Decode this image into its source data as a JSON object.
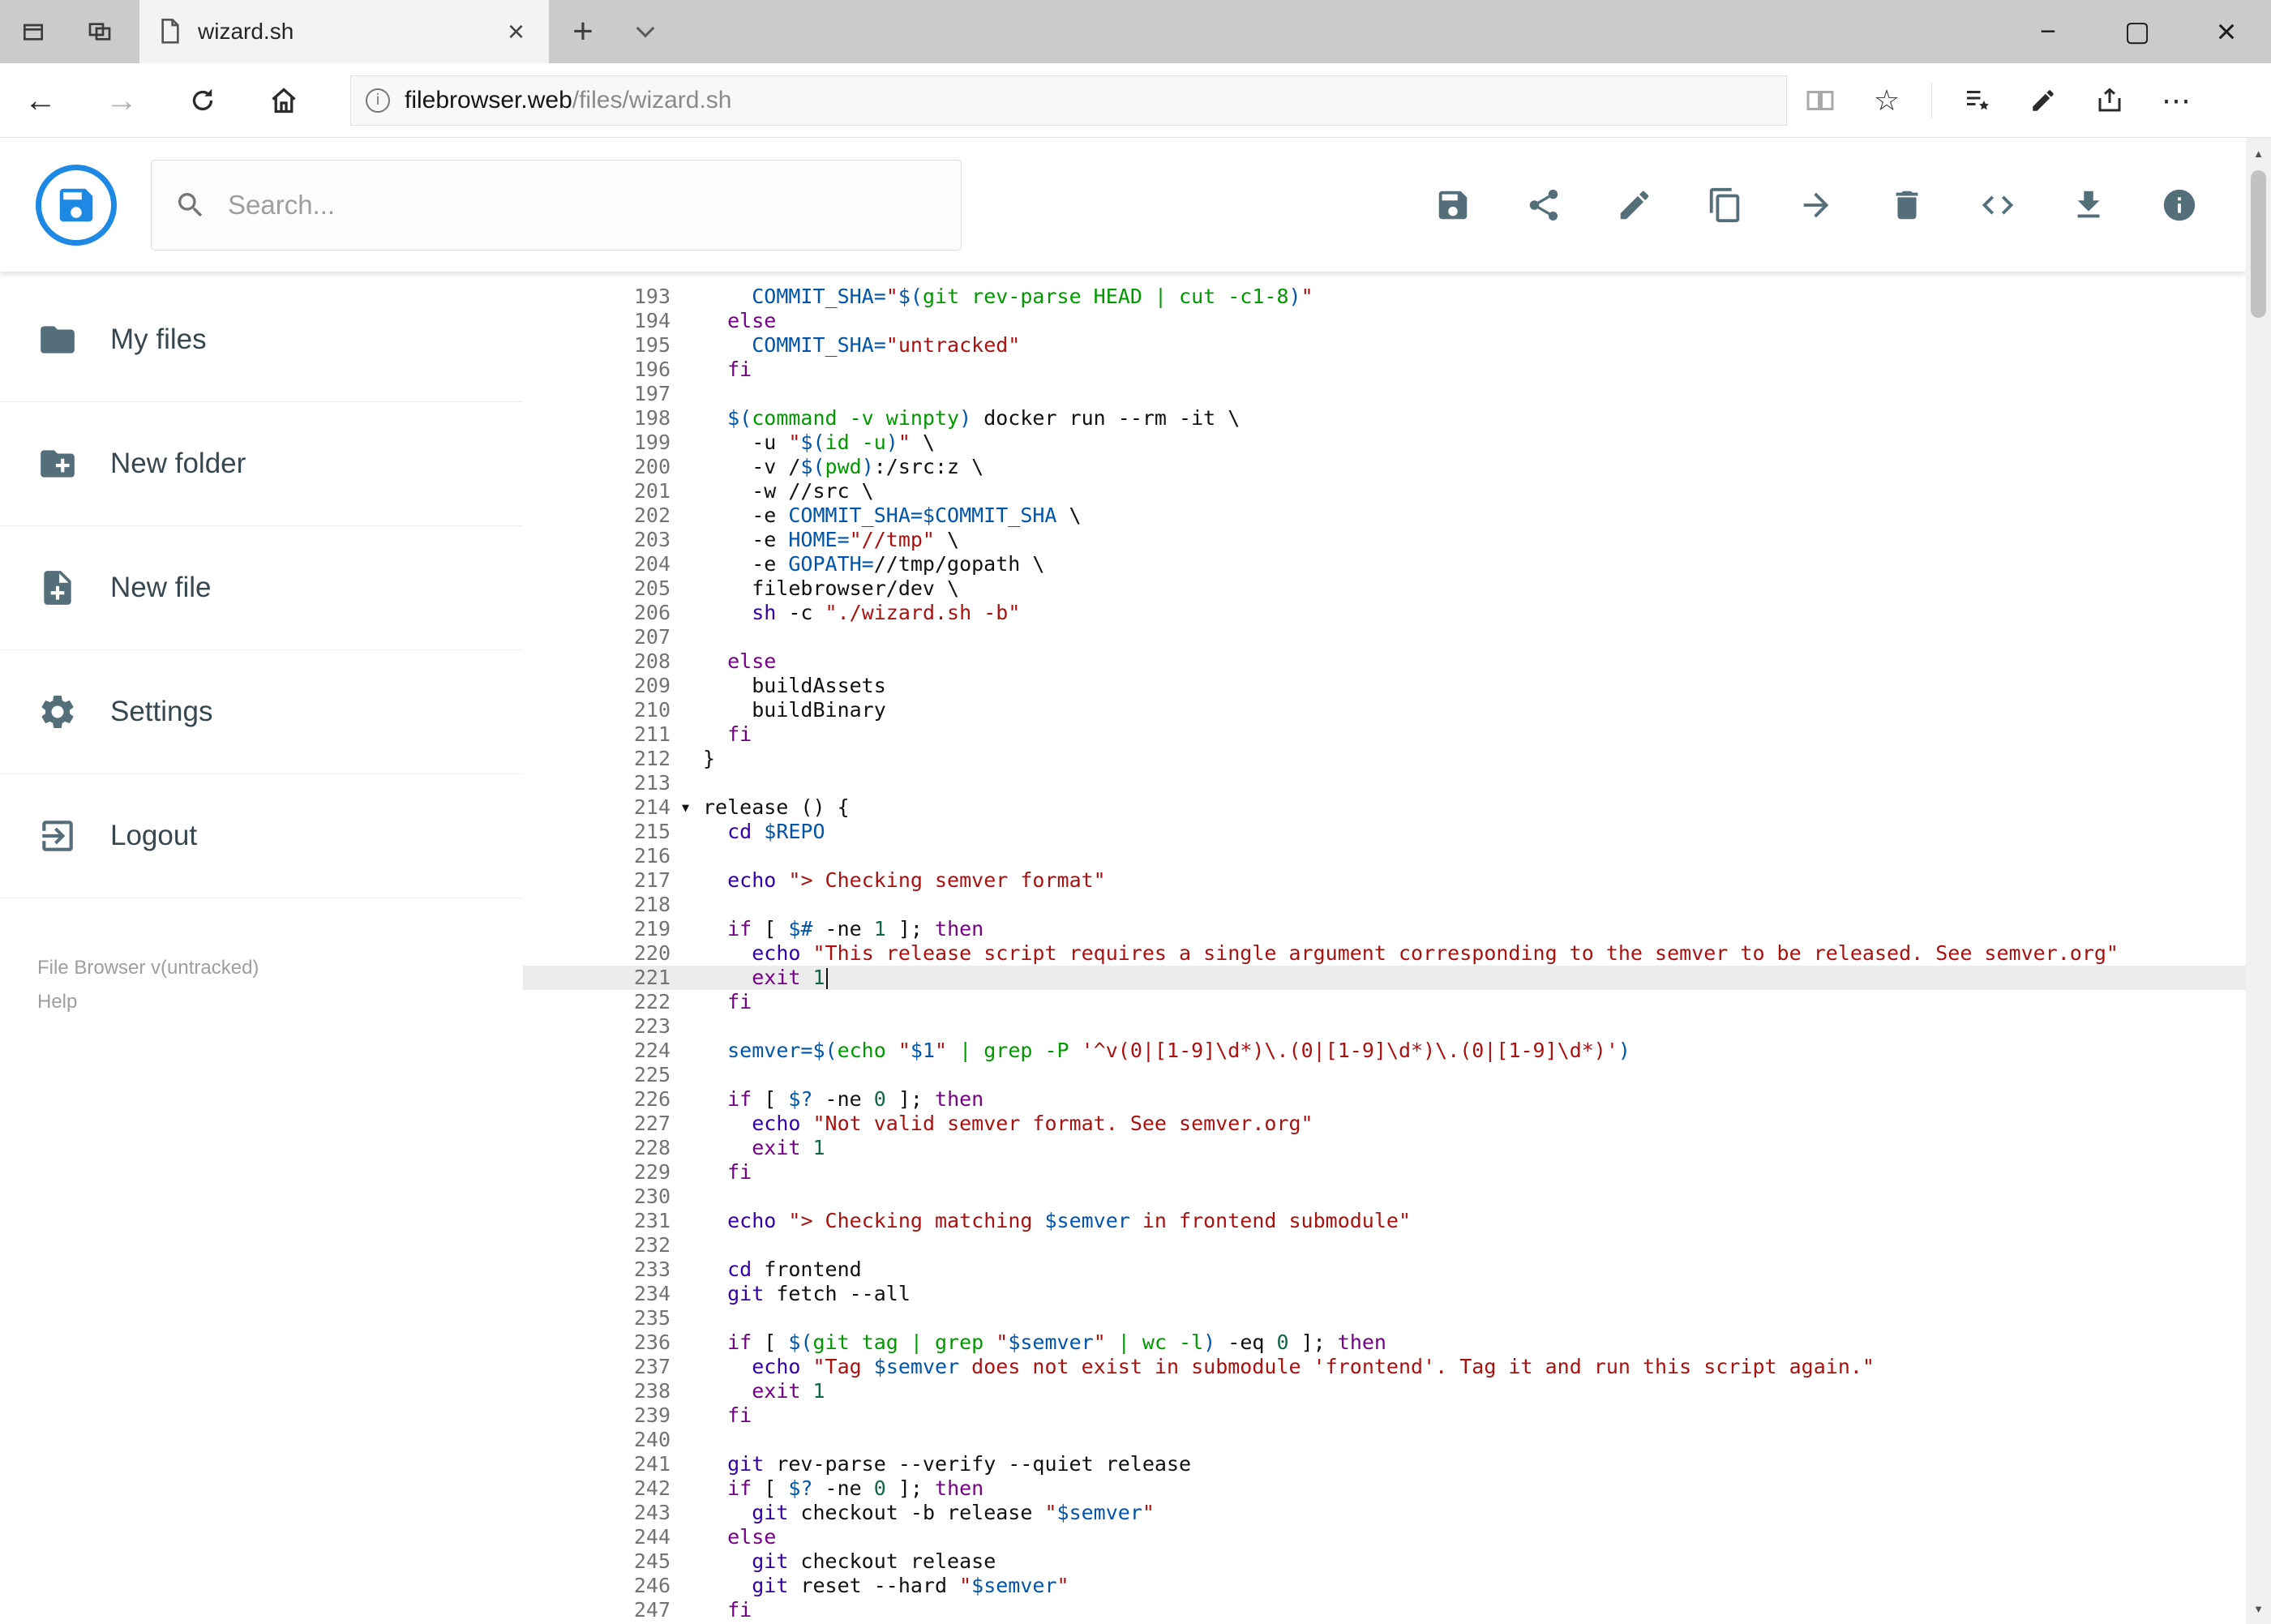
{
  "browser": {
    "tab": {
      "title": "wizard.sh",
      "close": "×"
    },
    "new_tab": "+",
    "window_controls": {
      "minimize": "−",
      "maximize": "▢",
      "close": "×"
    },
    "nav": {
      "back": "←",
      "forward": "→"
    },
    "url": {
      "host": "filebrowser.web",
      "path": "/files/wizard.sh"
    },
    "actions": {
      "star": "☆",
      "more": "⋯"
    }
  },
  "app": {
    "search": {
      "placeholder": "Search..."
    },
    "toolbar_icons": [
      "save",
      "share",
      "edit",
      "copy",
      "move",
      "delete",
      "code",
      "download",
      "info"
    ],
    "sidebar": {
      "items": [
        {
          "id": "my-files",
          "label": "My files"
        },
        {
          "id": "new-folder",
          "label": "New folder"
        },
        {
          "id": "new-file",
          "label": "New file"
        },
        {
          "id": "settings",
          "label": "Settings"
        },
        {
          "id": "logout",
          "label": "Logout"
        }
      ],
      "footer": {
        "version": "File Browser v(untracked)",
        "help": "Help"
      }
    }
  },
  "colors": {
    "brand_blue": "#1e88e5",
    "icon_slate": "#546e7a",
    "active_line_bg": "#ececec",
    "keyword": "#770088",
    "builtin": "#3300aa",
    "string": "#aa1111",
    "number": "#116644",
    "variable": "#0055aa",
    "command_substitution": "#009900",
    "line_number": "#737373"
  },
  "editor": {
    "active_line": 221,
    "cursor_line": 221,
    "fold_marker": "▼",
    "lines": [
      {
        "n": 193,
        "tk": [
          [
            "t",
            "    "
          ],
          [
            "v",
            "COMMIT_SHA="
          ],
          [
            "s",
            "\""
          ],
          [
            "v",
            "$("
          ],
          [
            "q",
            "git rev-parse HEAD | cut -c1-8"
          ],
          [
            "v",
            ")"
          ],
          [
            "s",
            "\""
          ]
        ]
      },
      {
        "n": 194,
        "tk": [
          [
            "t",
            "  "
          ],
          [
            "k",
            "else"
          ]
        ]
      },
      {
        "n": 195,
        "tk": [
          [
            "t",
            "    "
          ],
          [
            "v",
            "COMMIT_SHA="
          ],
          [
            "s",
            "\"untracked\""
          ]
        ]
      },
      {
        "n": 196,
        "tk": [
          [
            "t",
            "  "
          ],
          [
            "k",
            "fi"
          ]
        ]
      },
      {
        "n": 197,
        "tk": []
      },
      {
        "n": 198,
        "tk": [
          [
            "t",
            "  "
          ],
          [
            "v",
            "$("
          ],
          [
            "q",
            "command -v winpty"
          ],
          [
            "v",
            ")"
          ],
          [
            "t",
            " docker run --rm -it \\"
          ]
        ]
      },
      {
        "n": 199,
        "tk": [
          [
            "t",
            "    -u "
          ],
          [
            "s",
            "\""
          ],
          [
            "v",
            "$("
          ],
          [
            "q",
            "id -u"
          ],
          [
            "v",
            ")"
          ],
          [
            "s",
            "\""
          ],
          [
            "t",
            " \\"
          ]
        ]
      },
      {
        "n": 200,
        "tk": [
          [
            "t",
            "    -v /"
          ],
          [
            "v",
            "$("
          ],
          [
            "q",
            "pwd"
          ],
          [
            "v",
            ")"
          ],
          [
            "t",
            ":/src:z \\"
          ]
        ]
      },
      {
        "n": 201,
        "tk": [
          [
            "t",
            "    -w //src \\"
          ]
        ]
      },
      {
        "n": 202,
        "tk": [
          [
            "t",
            "    -e "
          ],
          [
            "v",
            "COMMIT_SHA=$COMMIT_SHA"
          ],
          [
            "t",
            " \\"
          ]
        ]
      },
      {
        "n": 203,
        "tk": [
          [
            "t",
            "    -e "
          ],
          [
            "v",
            "HOME="
          ],
          [
            "s",
            "\"//tmp\""
          ],
          [
            "t",
            " \\"
          ]
        ]
      },
      {
        "n": 204,
        "tk": [
          [
            "t",
            "    -e "
          ],
          [
            "v",
            "GOPATH="
          ],
          [
            "t",
            "//tmp/gopath \\"
          ]
        ]
      },
      {
        "n": 205,
        "tk": [
          [
            "t",
            "    filebrowser/dev \\"
          ]
        ]
      },
      {
        "n": 206,
        "tk": [
          [
            "t",
            "    "
          ],
          [
            "b",
            "sh"
          ],
          [
            "t",
            " -c "
          ],
          [
            "s",
            "\"./wizard.sh -b\""
          ]
        ]
      },
      {
        "n": 207,
        "tk": []
      },
      {
        "n": 208,
        "tk": [
          [
            "t",
            "  "
          ],
          [
            "k",
            "else"
          ]
        ]
      },
      {
        "n": 209,
        "tk": [
          [
            "t",
            "    buildAssets"
          ]
        ]
      },
      {
        "n": 210,
        "tk": [
          [
            "t",
            "    buildBinary"
          ]
        ]
      },
      {
        "n": 211,
        "tk": [
          [
            "t",
            "  "
          ],
          [
            "k",
            "fi"
          ]
        ]
      },
      {
        "n": 212,
        "tk": [
          [
            "t",
            "}"
          ]
        ]
      },
      {
        "n": 213,
        "tk": []
      },
      {
        "n": 214,
        "fold": true,
        "tk": [
          [
            "t",
            "release () {"
          ]
        ]
      },
      {
        "n": 215,
        "tk": [
          [
            "t",
            "  "
          ],
          [
            "b",
            "cd"
          ],
          [
            "t",
            " "
          ],
          [
            "v",
            "$REPO"
          ]
        ]
      },
      {
        "n": 216,
        "tk": []
      },
      {
        "n": 217,
        "tk": [
          [
            "t",
            "  "
          ],
          [
            "b",
            "echo"
          ],
          [
            "t",
            " "
          ],
          [
            "s",
            "\"> Checking semver format\""
          ]
        ]
      },
      {
        "n": 218,
        "tk": []
      },
      {
        "n": 219,
        "tk": [
          [
            "t",
            "  "
          ],
          [
            "k",
            "if"
          ],
          [
            "t",
            " [ "
          ],
          [
            "v",
            "$#"
          ],
          [
            "t",
            " -ne "
          ],
          [
            "n2",
            "1"
          ],
          [
            "t",
            " ]; "
          ],
          [
            "k",
            "then"
          ]
        ]
      },
      {
        "n": 220,
        "tk": [
          [
            "t",
            "    "
          ],
          [
            "b",
            "echo"
          ],
          [
            "t",
            " "
          ],
          [
            "s",
            "\"This release script requires a single argument corresponding to the semver to be released. See semver.org\""
          ]
        ]
      },
      {
        "n": 221,
        "tk": [
          [
            "t",
            "    "
          ],
          [
            "k",
            "exit"
          ],
          [
            "t",
            " "
          ],
          [
            "n2",
            "1"
          ]
        ]
      },
      {
        "n": 222,
        "tk": [
          [
            "t",
            "  "
          ],
          [
            "k",
            "fi"
          ]
        ]
      },
      {
        "n": 223,
        "tk": []
      },
      {
        "n": 224,
        "tk": [
          [
            "t",
            "  "
          ],
          [
            "v",
            "semver=$("
          ],
          [
            "q",
            "echo "
          ],
          [
            "s",
            "\""
          ],
          [
            "v",
            "$1"
          ],
          [
            "s",
            "\""
          ],
          [
            "q",
            " | grep -P "
          ],
          [
            "s",
            "'^v(0|[1-9]\\d*)\\.(0|[1-9]\\d*)\\.(0|[1-9]\\d*)'"
          ],
          [
            "v",
            ")"
          ]
        ]
      },
      {
        "n": 225,
        "tk": []
      },
      {
        "n": 226,
        "tk": [
          [
            "t",
            "  "
          ],
          [
            "k",
            "if"
          ],
          [
            "t",
            " [ "
          ],
          [
            "v",
            "$?"
          ],
          [
            "t",
            " -ne "
          ],
          [
            "n2",
            "0"
          ],
          [
            "t",
            " ]; "
          ],
          [
            "k",
            "then"
          ]
        ]
      },
      {
        "n": 227,
        "tk": [
          [
            "t",
            "    "
          ],
          [
            "b",
            "echo"
          ],
          [
            "t",
            " "
          ],
          [
            "s",
            "\"Not valid semver format. See semver.org\""
          ]
        ]
      },
      {
        "n": 228,
        "tk": [
          [
            "t",
            "    "
          ],
          [
            "k",
            "exit"
          ],
          [
            "t",
            " "
          ],
          [
            "n2",
            "1"
          ]
        ]
      },
      {
        "n": 229,
        "tk": [
          [
            "t",
            "  "
          ],
          [
            "k",
            "fi"
          ]
        ]
      },
      {
        "n": 230,
        "tk": []
      },
      {
        "n": 231,
        "tk": [
          [
            "t",
            "  "
          ],
          [
            "b",
            "echo"
          ],
          [
            "t",
            " "
          ],
          [
            "s",
            "\"> Checking matching "
          ],
          [
            "v",
            "$semver"
          ],
          [
            "s",
            " in frontend submodule\""
          ]
        ]
      },
      {
        "n": 232,
        "tk": []
      },
      {
        "n": 233,
        "tk": [
          [
            "t",
            "  "
          ],
          [
            "b",
            "cd"
          ],
          [
            "t",
            " frontend"
          ]
        ]
      },
      {
        "n": 234,
        "tk": [
          [
            "t",
            "  "
          ],
          [
            "b",
            "git"
          ],
          [
            "t",
            " fetch --all"
          ]
        ]
      },
      {
        "n": 235,
        "tk": []
      },
      {
        "n": 236,
        "tk": [
          [
            "t",
            "  "
          ],
          [
            "k",
            "if"
          ],
          [
            "t",
            " [ "
          ],
          [
            "v",
            "$("
          ],
          [
            "q",
            "git tag | grep "
          ],
          [
            "s",
            "\""
          ],
          [
            "v",
            "$semver"
          ],
          [
            "s",
            "\""
          ],
          [
            "q",
            " | wc -l"
          ],
          [
            "v",
            ")"
          ],
          [
            "t",
            " -eq "
          ],
          [
            "n2",
            "0"
          ],
          [
            "t",
            " ]; "
          ],
          [
            "k",
            "then"
          ]
        ]
      },
      {
        "n": 237,
        "tk": [
          [
            "t",
            "    "
          ],
          [
            "b",
            "echo"
          ],
          [
            "t",
            " "
          ],
          [
            "s",
            "\"Tag "
          ],
          [
            "v",
            "$semver"
          ],
          [
            "s",
            " does not exist in submodule 'frontend'. Tag it and run this script again.\""
          ]
        ]
      },
      {
        "n": 238,
        "tk": [
          [
            "t",
            "    "
          ],
          [
            "k",
            "exit"
          ],
          [
            "t",
            " "
          ],
          [
            "n2",
            "1"
          ]
        ]
      },
      {
        "n": 239,
        "tk": [
          [
            "t",
            "  "
          ],
          [
            "k",
            "fi"
          ]
        ]
      },
      {
        "n": 240,
        "tk": []
      },
      {
        "n": 241,
        "tk": [
          [
            "t",
            "  "
          ],
          [
            "b",
            "git"
          ],
          [
            "t",
            " rev-parse --verify --quiet release"
          ]
        ]
      },
      {
        "n": 242,
        "tk": [
          [
            "t",
            "  "
          ],
          [
            "k",
            "if"
          ],
          [
            "t",
            " [ "
          ],
          [
            "v",
            "$?"
          ],
          [
            "t",
            " -ne "
          ],
          [
            "n2",
            "0"
          ],
          [
            "t",
            " ]; "
          ],
          [
            "k",
            "then"
          ]
        ]
      },
      {
        "n": 243,
        "tk": [
          [
            "t",
            "    "
          ],
          [
            "b",
            "git"
          ],
          [
            "t",
            " checkout -b release "
          ],
          [
            "s",
            "\""
          ],
          [
            "v",
            "$semver"
          ],
          [
            "s",
            "\""
          ]
        ]
      },
      {
        "n": 244,
        "tk": [
          [
            "t",
            "  "
          ],
          [
            "k",
            "else"
          ]
        ]
      },
      {
        "n": 245,
        "tk": [
          [
            "t",
            "    "
          ],
          [
            "b",
            "git"
          ],
          [
            "t",
            " checkout release"
          ]
        ]
      },
      {
        "n": 246,
        "tk": [
          [
            "t",
            "    "
          ],
          [
            "b",
            "git"
          ],
          [
            "t",
            " reset --hard "
          ],
          [
            "s",
            "\""
          ],
          [
            "v",
            "$semver"
          ],
          [
            "s",
            "\""
          ]
        ]
      },
      {
        "n": 247,
        "tk": [
          [
            "t",
            "  "
          ],
          [
            "k",
            "fi"
          ]
        ]
      }
    ]
  }
}
